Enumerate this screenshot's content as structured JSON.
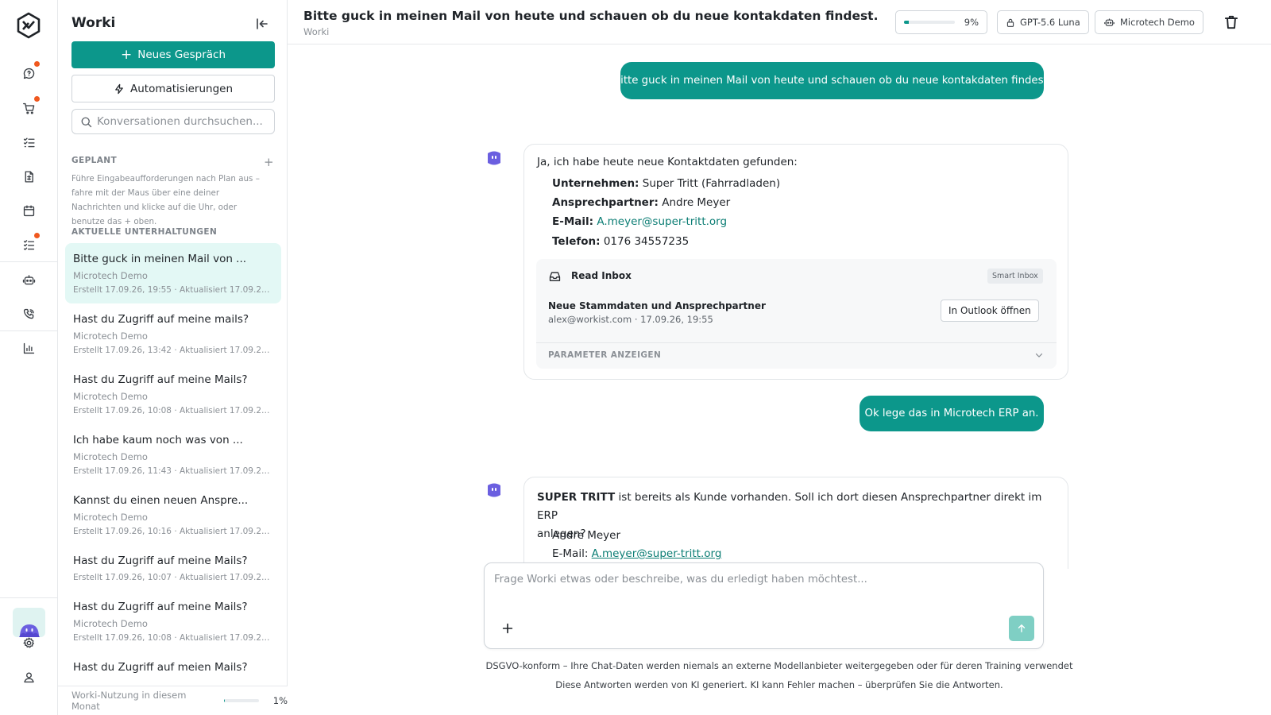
{
  "colors": {
    "accent": "#0c978b",
    "notification": "#f0581f",
    "link": "#0b7d74"
  },
  "rail": {
    "icons": [
      "chat-icon",
      "cart-icon",
      "checklist-icon",
      "document-icon",
      "calendar-icon",
      "tasks-icon",
      "robot-icon",
      "phone-icon",
      "chart-icon",
      "gear-icon",
      "user-icon"
    ]
  },
  "sidebar": {
    "brand": "Worki",
    "new_chat": "Neues Gespräch",
    "automations": "Automatisierungen",
    "search_placeholder": "Konversationen durchsuchen...",
    "planned_label": "GEPLANT",
    "planned_desc": "Führe Eingabeaufforderungen nach Plan aus – fahre mit der Maus über eine deiner Nachrichten und klicke auf die Uhr, oder benutze das + oben.",
    "recent_label": "AKTUELLE UNTERHALTUNGEN",
    "conversations": [
      {
        "title": "Bitte guck in meinen Mail von ...",
        "subtitle": "Microtech Demo",
        "meta": "Erstellt 17.09.26, 19:55 · Aktualisiert 17.09.26, ...",
        "active": true
      },
      {
        "title": "Hast du Zugriff auf meine mails?",
        "subtitle": "Microtech Demo",
        "meta": "Erstellt 17.09.26, 13:42 · Aktualisiert 17.09.26, ..."
      },
      {
        "title": "Hast du Zugriff auf meine Mails?",
        "subtitle": "Microtech Demo",
        "meta": "Erstellt 17.09.26, 10:08 · Aktualisiert 17.09.26, ..."
      },
      {
        "title": "Ich habe kaum noch was von ...",
        "subtitle": "Microtech Demo",
        "meta": "Erstellt 17.09.26, 11:43 · Aktualisiert 17.09.26, ..."
      },
      {
        "title": "Kannst du einen neuen Anspre...",
        "subtitle": "Microtech Demo",
        "meta": "Erstellt 17.09.26, 10:16 · Aktualisiert 17.09.26, ..."
      },
      {
        "title": "Hast du Zugriff auf meine Mails?",
        "subtitle": "",
        "meta": "Erstellt 17.09.26, 10:07 · Aktualisiert 17.09.26, ..."
      },
      {
        "title": "Hast du Zugriff auf meine Mails?",
        "subtitle": "Microtech Demo",
        "meta": "Erstellt 17.09.26, 10:08 · Aktualisiert 17.09.26, ..."
      },
      {
        "title": "Hast du Zugriff auf meien Mails?",
        "subtitle": "",
        "meta": ""
      }
    ],
    "usage_label": "Worki-Nutzung in diesem Monat",
    "usage_pct": "1%",
    "usage_value": 1
  },
  "header": {
    "title": "Bitte guck in meinen Mail von heute und schauen ob du neue kontakdaten findest.",
    "subtitle": "Worki",
    "progress_pct": "9%",
    "progress_value": 9,
    "model": "GPT-5.6 Luna",
    "workspace": "Microtech Demo"
  },
  "chat": {
    "user1": "Bitte guck in meinen Mail von heute und schauen ob du neue kontakdaten findest.",
    "assistant1": {
      "intro": "Ja, ich habe heute neue Kontaktdaten gefunden:",
      "company_label": "Unternehmen:",
      "company": "Super Tritt (Fahrradladen)",
      "contact_label": "Ansprechpartner:",
      "contact": "Andre Meyer",
      "email_label": "E-Mail:",
      "email": "A.meyer@super-tritt.org",
      "phone_label": "Telefon:",
      "phone": "0176 34557235"
    },
    "tool": {
      "name": "Read Inbox",
      "tag": "Smart Inbox",
      "mail_title": "Neue Stammdaten und Ansprechpartner",
      "mail_meta": "alex@workist.com · 17.09.26, 19:55",
      "open_label": "In Outlook öffnen",
      "params_label": "PARAMETER ANZEIGEN"
    },
    "user2": "Ok lege das in Microtech ERP an.",
    "assistant2": {
      "bold": "SUPER TRITT",
      "text": " ist bereits als Kunde vorhanden. Soll ich dort diesen Ansprechpartner direkt im ERP",
      "text2": "anlegen?",
      "name": "Andre Meyer",
      "email_label": "E-Mail:",
      "email": "A.meyer@super-tritt.org"
    }
  },
  "composer": {
    "placeholder": "Frage Worki etwas oder beschreibe, was du erledigt haben möchtest..."
  },
  "footer": {
    "line1": "DSGVO-konform – Ihre Chat-Daten werden niemals an externe Modellanbieter weitergegeben oder für deren Training verwendet",
    "line2": "Diese Antworten werden von KI generiert. KI kann Fehler machen – überprüfen Sie die Antworten."
  }
}
